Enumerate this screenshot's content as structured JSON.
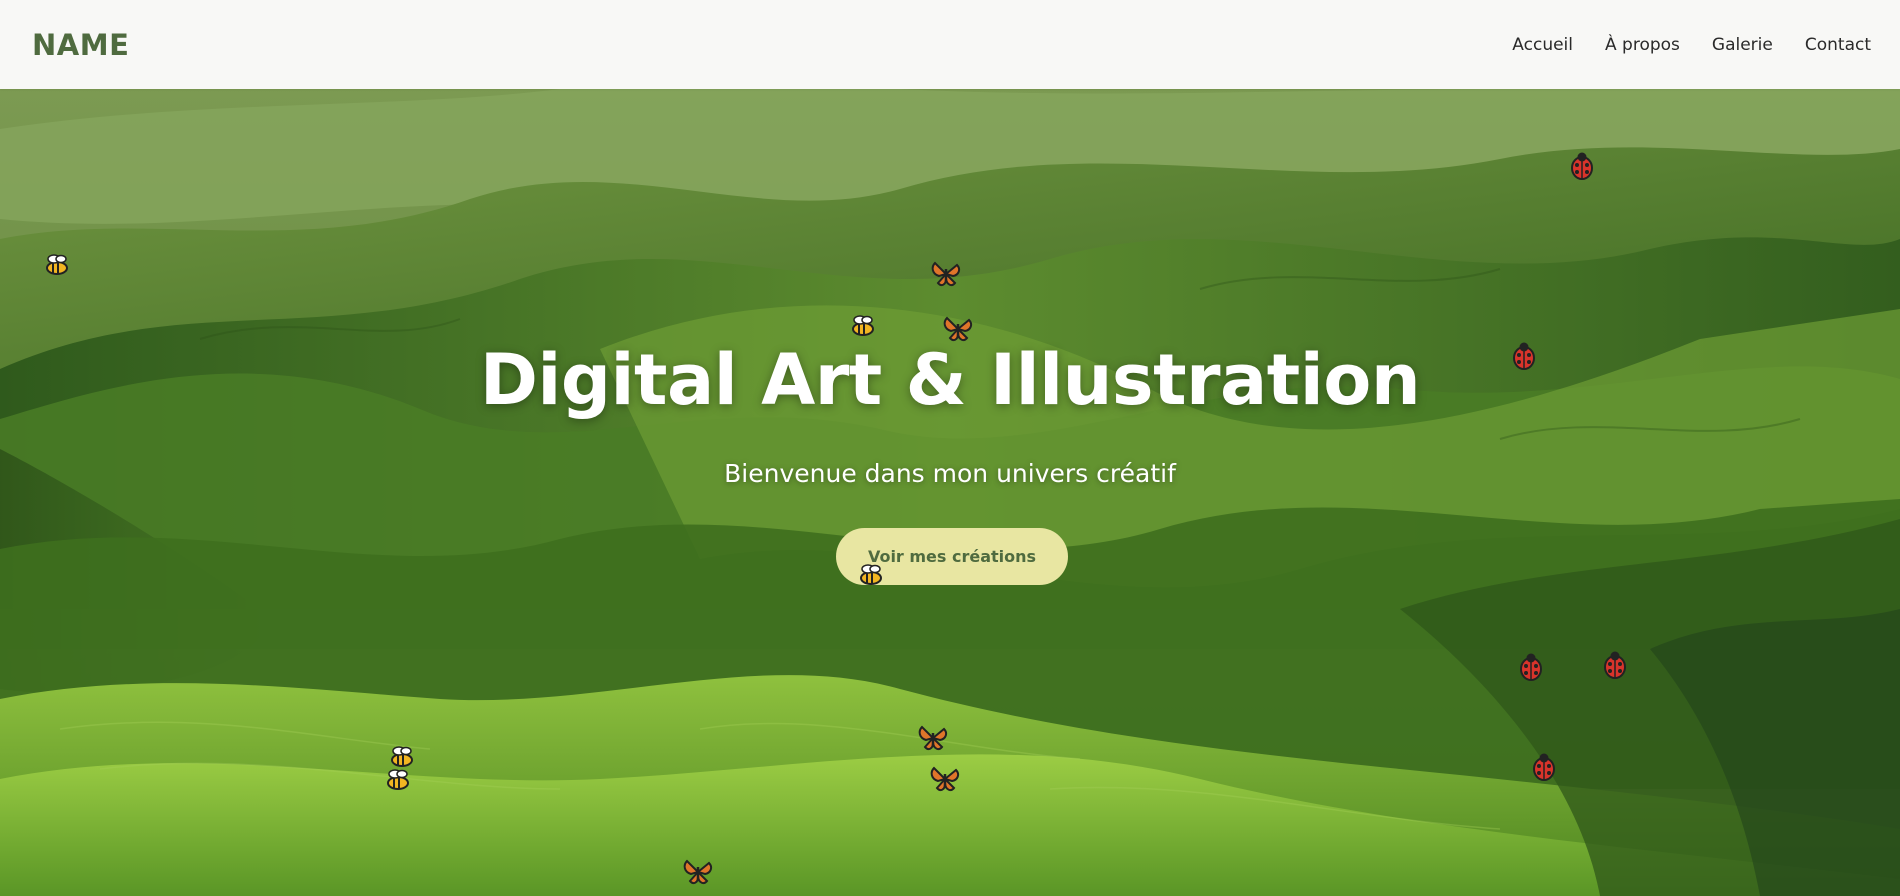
{
  "header": {
    "logo": "NAME",
    "nav": [
      {
        "label": "Accueil"
      },
      {
        "label": "À propos"
      },
      {
        "label": "Galerie"
      },
      {
        "label": "Contact"
      }
    ]
  },
  "hero": {
    "background": "rolling-green-hills-photo",
    "title": "Digital Art & Illustration",
    "subtitle": "Bienvenue dans mon univers créatif",
    "cta_label": "Voir mes créations"
  },
  "critters": [
    {
      "type": "bee-icon"
    },
    {
      "type": "butterfly-icon"
    },
    {
      "type": "bee-icon"
    },
    {
      "type": "butterfly-icon"
    },
    {
      "type": "ladybug-icon"
    },
    {
      "type": "ladybug-icon"
    },
    {
      "type": "bee-icon"
    },
    {
      "type": "ladybug-icon"
    },
    {
      "type": "ladybug-icon"
    },
    {
      "type": "butterfly-icon"
    },
    {
      "type": "butterfly-icon"
    },
    {
      "type": "bee-icon"
    },
    {
      "type": "bee-icon"
    },
    {
      "type": "ladybug-icon"
    },
    {
      "type": "butterfly-icon"
    }
  ],
  "colors": {
    "header_bg": "#f8f8f6",
    "logo": "#4f6b3f",
    "nav_text": "#2a2a2a",
    "hero_text": "#ffffff",
    "cta_bg": "#e8e6a2",
    "cta_text": "#4f6b3f"
  }
}
